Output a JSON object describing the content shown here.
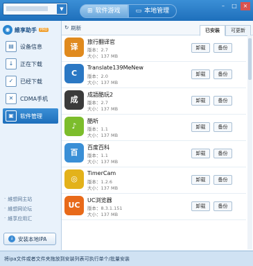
{
  "header": {
    "tabs": [
      {
        "label": "软件游戏",
        "icon": "game-icon",
        "active": true
      },
      {
        "label": "本地管理",
        "icon": "monitor-icon",
        "active": false
      }
    ],
    "device_drop": "▼",
    "window_controls": [
      "–",
      "□",
      "×"
    ]
  },
  "sidebar": {
    "brand": {
      "name": "維享助手",
      "badge": "PRO"
    },
    "items": [
      {
        "label": "设备信息",
        "icon": "device-info-icon",
        "active": false
      },
      {
        "label": "正在下载",
        "icon": "download-icon",
        "active": false
      },
      {
        "label": "已经下载",
        "icon": "check-icon",
        "active": false
      },
      {
        "label": "CDMA手机",
        "icon": "wrench-icon",
        "active": false
      },
      {
        "label": "软件管理",
        "icon": "software-icon",
        "active": true
      }
    ],
    "links": [
      "維想网主站",
      "維想网论坛",
      "維享应用汇"
    ],
    "install_button": "安装本地IPA"
  },
  "toolbar": {
    "refresh": "刷新",
    "subtabs": [
      {
        "label": "已安装",
        "active": true
      },
      {
        "label": "可更新",
        "active": false
      }
    ]
  },
  "apps": [
    {
      "name": "旅行翻译官",
      "version": "版本：2.7",
      "size": "大小：137 MB",
      "icon": "translator-app-icon",
      "color": "#e08a1e"
    },
    {
      "name": "Translate139MeNew",
      "version": "版本：2.0",
      "size": "大小：137 MB",
      "icon": "china-mobile-app-icon",
      "color": "#2b78c4"
    },
    {
      "name": "成語酷玩2",
      "version": "版本：2.7",
      "size": "大小：137 MB",
      "icon": "idiom-game-icon",
      "color": "#3b3b3b"
    },
    {
      "name": "酷听",
      "version": "版本：1.1",
      "size": "大小：137 MB",
      "icon": "kuting-app-icon",
      "color": "#7cbd2c"
    },
    {
      "name": "百度百科",
      "version": "版本：1.1",
      "size": "大小：137 MB",
      "icon": "baidu-baike-icon",
      "color": "#3a8fd6"
    },
    {
      "name": "TimerCam",
      "version": "版本：1.2.6",
      "size": "大小：137 MB",
      "icon": "timercam-app-icon",
      "color": "#e3b21b"
    },
    {
      "name": "UC浏览器",
      "version": "版本：8.3.1.151",
      "size": "大小：137 MB",
      "icon": "uc-browser-icon",
      "color": "#e86a1a"
    }
  ],
  "buttons": {
    "uninstall": "卸载",
    "backup": "备份"
  },
  "status": "将ipa文件或者文件夹拖放到安装列表可执行单个/批量安装"
}
